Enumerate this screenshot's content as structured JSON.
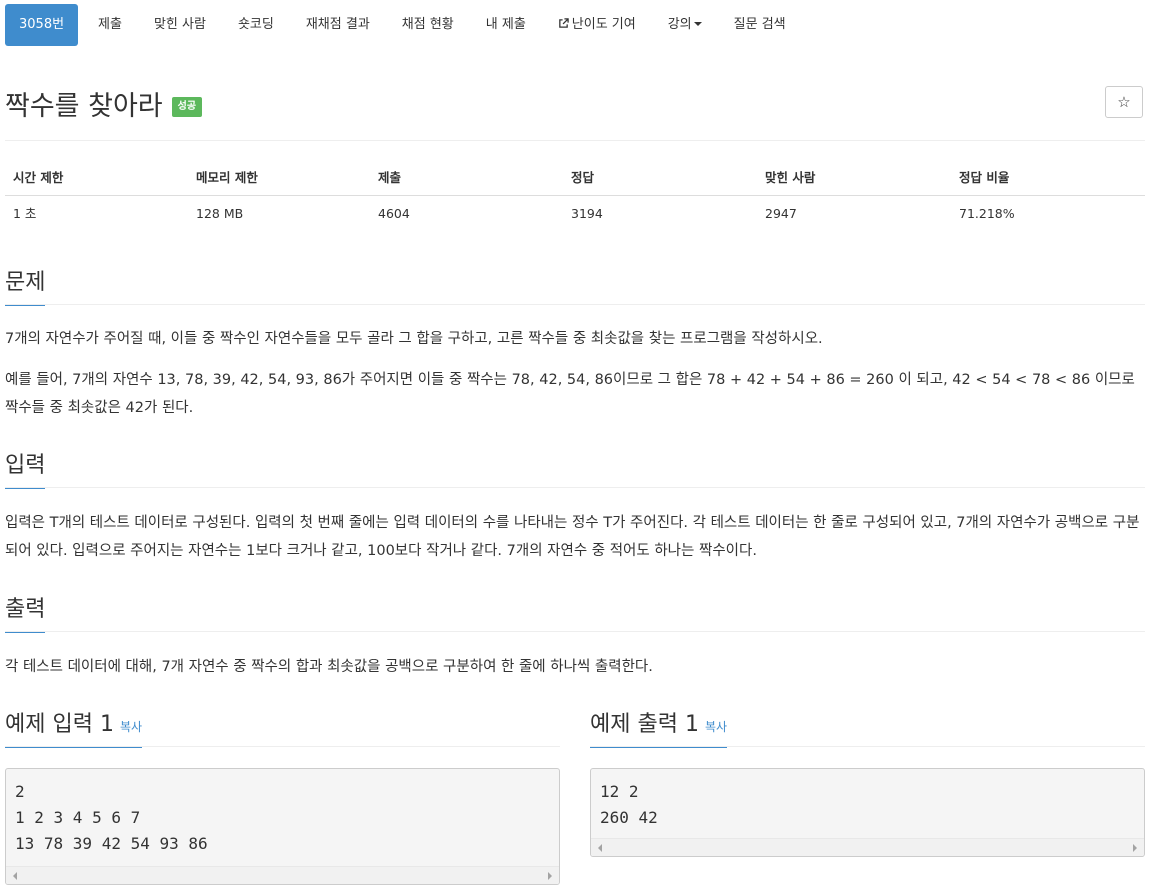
{
  "nav": {
    "items": [
      {
        "label": "3058번",
        "active": true
      },
      {
        "label": "제출"
      },
      {
        "label": "맞힌 사람"
      },
      {
        "label": "숏코딩"
      },
      {
        "label": "재채점 결과"
      },
      {
        "label": "채점 현황"
      },
      {
        "label": "내 제출"
      },
      {
        "label": "난이도 기여",
        "icon": "external-link-icon"
      },
      {
        "label": "강의",
        "icon": "caret-down-icon"
      },
      {
        "label": "질문 검색"
      }
    ]
  },
  "problem": {
    "title": "짝수를 찾아라",
    "badge": "성공",
    "star_icon": "☆"
  },
  "stats": {
    "headers": [
      "시간 제한",
      "메모리 제한",
      "제출",
      "정답",
      "맞힌 사람",
      "정답 비율"
    ],
    "values": [
      "1 초",
      "128 MB",
      "4604",
      "3194",
      "2947",
      "71.218%"
    ]
  },
  "sections": {
    "problem_title": "문제",
    "problem_p1": "7개의 자연수가 주어질 때, 이들 중 짝수인 자연수들을 모두 골라 그 합을 구하고, 고른 짝수들 중 최솟값을 찾는 프로그램을 작성하시오.",
    "problem_p2": "예를 들어, 7개의 자연수 13, 78, 39, 42, 54, 93, 86가 주어지면 이들 중 짝수는 78, 42, 54, 86이므로 그 합은 78 + 42 + 54 + 86 = 260 이 되고, 42 < 54 < 78 < 86 이므로 짝수들 중 최솟값은 42가 된다.",
    "input_title": "입력",
    "input_p": "입력은 T개의 테스트 데이터로 구성된다. 입력의 첫 번째 줄에는 입력 데이터의 수를 나타내는 정수 T가 주어진다. 각 테스트 데이터는 한 줄로 구성되어 있고, 7개의 자연수가 공백으로 구분되어 있다. 입력으로 주어지는 자연수는 1보다 크거나 같고, 100보다 작거나 같다. 7개의 자연수 중 적어도 하나는 짝수이다.",
    "output_title": "출력",
    "output_p": "각 테스트 데이터에 대해, 7개 자연수 중 짝수의 합과 최솟값을 공백으로 구분하여 한 줄에 하나씩 출력한다."
  },
  "samples": {
    "input_title": "예제 입력 1",
    "output_title": "예제 출력 1",
    "copy_label": "복사",
    "input_text": "2\n1 2 3 4 5 6 7\n13 78 39 42 54 93 86",
    "output_text": "12 2\n260 42"
  }
}
